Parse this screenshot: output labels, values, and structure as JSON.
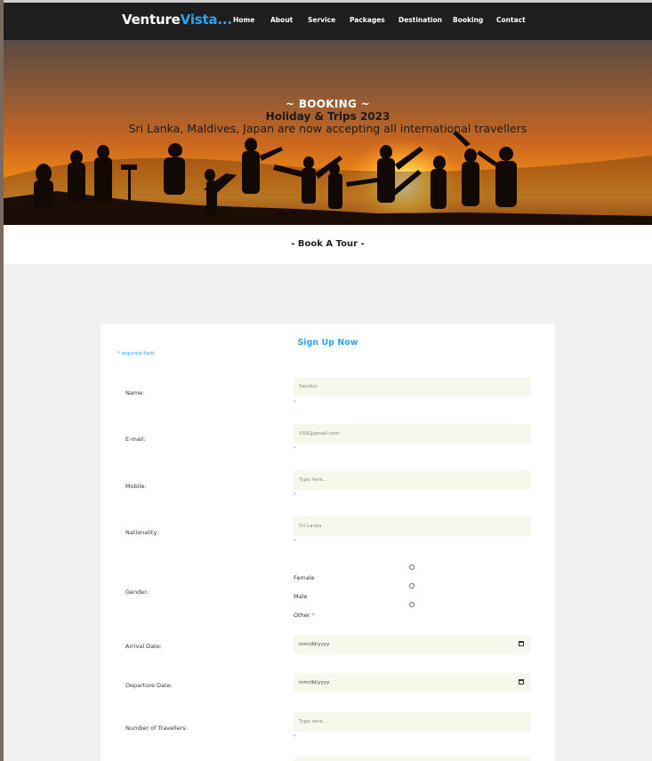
{
  "nav": {
    "logo_main": "Venture",
    "logo_accent": "Vista...",
    "links": [
      "Home",
      "About",
      "Service",
      "Packages",
      "Destination",
      "Booking",
      "Contact"
    ]
  },
  "hero": {
    "title": "~ BOOKING ~",
    "subtitle": "Holiday & Trips 2023",
    "tagline": "Sri Lanka, Maldives, Japan are now accepting all international travellers"
  },
  "section": {
    "title": "- Book A Tour -"
  },
  "form": {
    "title": "Sign Up Now",
    "required_note": "* required field",
    "required_mark": "*",
    "name": {
      "label": "Name:",
      "placeholder": "Sandun"
    },
    "email": {
      "label": "E-mail:",
      "placeholder": "XXX@gmail.com"
    },
    "mobile": {
      "label": "Mobile:",
      "placeholder": "Type here..."
    },
    "nationality": {
      "label": "Nationality:",
      "placeholder": "Sri Lanka"
    },
    "gender": {
      "label": "Gender:",
      "options": [
        "Female",
        "Male",
        "Other"
      ]
    },
    "arrival": {
      "label": "Arrival Date:",
      "placeholder": "mm/dd/yyyy"
    },
    "departure": {
      "label": "Departure Date:",
      "placeholder": "mm/dd/yyyy"
    },
    "travellers": {
      "label": "Number of Travellers:",
      "placeholder": "Type here..."
    }
  },
  "colors": {
    "accent": "#2ea3f2",
    "nav_bg": "#1e1e1e",
    "input_bg": "#f4f9ec"
  }
}
